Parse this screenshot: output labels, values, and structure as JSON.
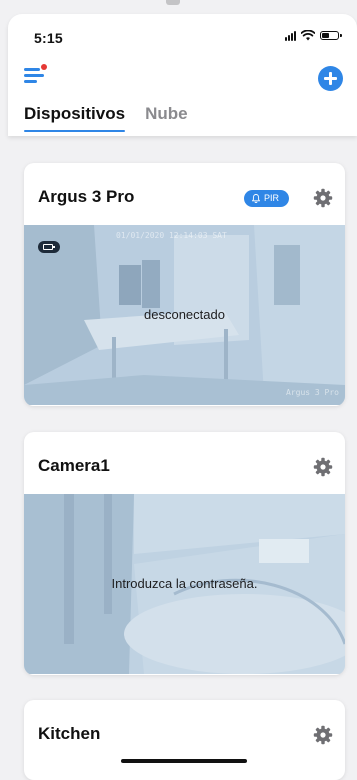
{
  "status_bar": {
    "time": "5:15"
  },
  "header": {
    "menu_icon": "menu-icon",
    "add_icon": "add-device-icon",
    "tabs": [
      {
        "label": "Dispositivos",
        "active": true
      },
      {
        "label": "Nube",
        "active": false
      }
    ]
  },
  "devices": [
    {
      "name": "Argus 3 Pro",
      "pir_label": "PIR",
      "status": "desconectado",
      "camera_timestamp": "01/01/2020 12:14:03 SAT",
      "camera_label": "Argus 3 Pro"
    },
    {
      "name": "Camera1",
      "status": "Introduzca la contraseña."
    },
    {
      "name": "Kitchen"
    }
  ],
  "colors": {
    "accent": "#2f86e6",
    "badge_dot": "#e53935",
    "background": "#f1f1f3"
  }
}
